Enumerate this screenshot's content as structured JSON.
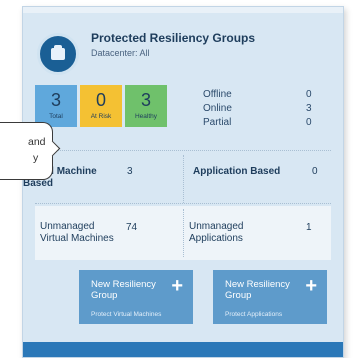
{
  "header": {
    "title": "Protected Resiliency Groups",
    "subtitle": "Datacenter: All"
  },
  "tiles": [
    {
      "value": "3",
      "label": "Total",
      "color": "#5fa8dc"
    },
    {
      "value": "0",
      "label": "At Risk",
      "color": "#f4c133"
    },
    {
      "value": "3",
      "label": "Healthy",
      "color": "#6fc16b"
    }
  ],
  "stats": [
    {
      "label": "Offline",
      "value": "0"
    },
    {
      "label": "Online",
      "value": "3"
    },
    {
      "label": "Partial",
      "value": "0"
    }
  ],
  "grid": {
    "vm_based_label": "Virtual Machine Based",
    "vm_based_value": "3",
    "app_based_label": "Application Based",
    "app_based_value": "0",
    "unmanaged_vm_label": "Unmanaged Virtual Machines",
    "unmanaged_vm_value": "74",
    "unmanaged_app_label": "Unmanaged Applications",
    "unmanaged_app_value": "1"
  },
  "buttons": [
    {
      "line1": "New Resiliency",
      "line2": "Group",
      "sub": "Protect Virtual Machines",
      "icon": "plus-icon"
    },
    {
      "line1": "New Resiliency",
      "line2": "Group",
      "sub": "Protect Applications",
      "icon": "plus-icon"
    }
  ],
  "tooltip": {
    "line1": "and",
    "line2": "y"
  }
}
